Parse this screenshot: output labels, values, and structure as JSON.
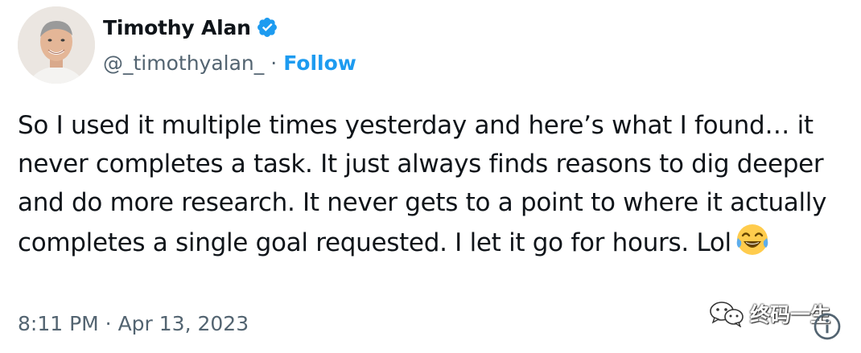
{
  "author": {
    "display_name": "Timothy Alan",
    "handle": "@_timothyalan_",
    "separator": "·",
    "follow_label": "Follow",
    "verified": true
  },
  "tweet": {
    "text": "So I used it multiple times yesterday and here’s what I found… it never completes a task. It just always finds reasons to dig deeper and do more research. It never gets to a point to where it actually completes a single goal requested. I let it go for hours. Lol",
    "emoji": "face-with-tears-of-joy",
    "timestamp": "8:11 PM · Apr 13, 2023"
  },
  "watermark": {
    "text": "终码一生"
  },
  "colors": {
    "accent": "#1d9bf0",
    "text": "#0f1419",
    "secondary": "#536471"
  },
  "icons": {
    "verified": "verified-badge-icon",
    "info": "info-icon",
    "watermark": "wechat-icon"
  }
}
